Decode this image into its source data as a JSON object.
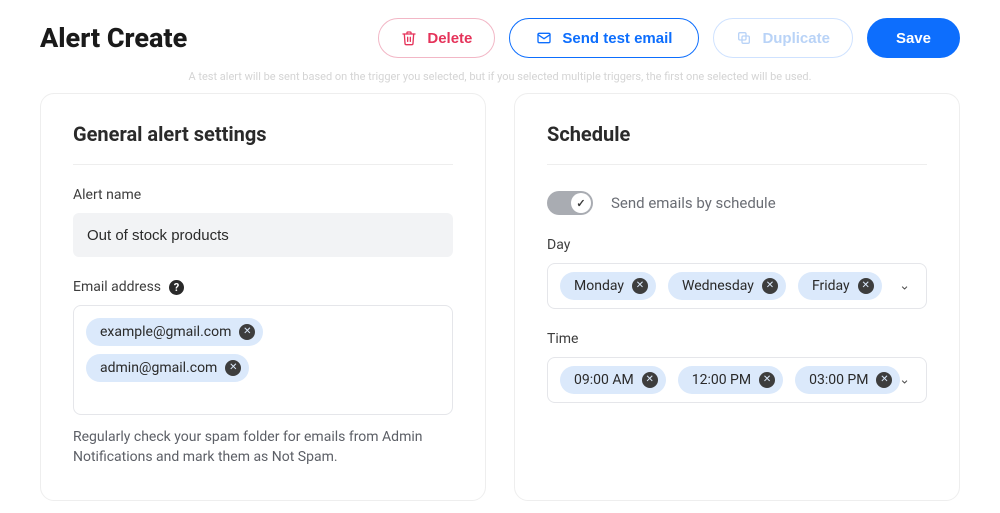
{
  "header": {
    "title": "Alert Create",
    "delete": "Delete",
    "send_test": "Send test email",
    "duplicate": "Duplicate",
    "save": "Save"
  },
  "subnote": "A test alert will be sent based on the trigger you selected, but if you selected multiple triggers, the first one selected will be used.",
  "general": {
    "heading": "General alert settings",
    "alert_name_label": "Alert name",
    "alert_name_value": "Out of stock products",
    "email_label": "Email address",
    "emails": [
      "example@gmail.com",
      "admin@gmail.com"
    ],
    "hint": "Regularly check your spam folder for emails from Admin Notifications and mark them as Not Spam."
  },
  "schedule": {
    "heading": "Schedule",
    "toggle_label": "Send emails by schedule",
    "toggle_on": true,
    "day_label": "Day",
    "days": [
      "Monday",
      "Wednesday",
      "Friday"
    ],
    "time_label": "Time",
    "times": [
      "09:00 AM",
      "12:00 PM",
      "03:00 PM"
    ]
  }
}
